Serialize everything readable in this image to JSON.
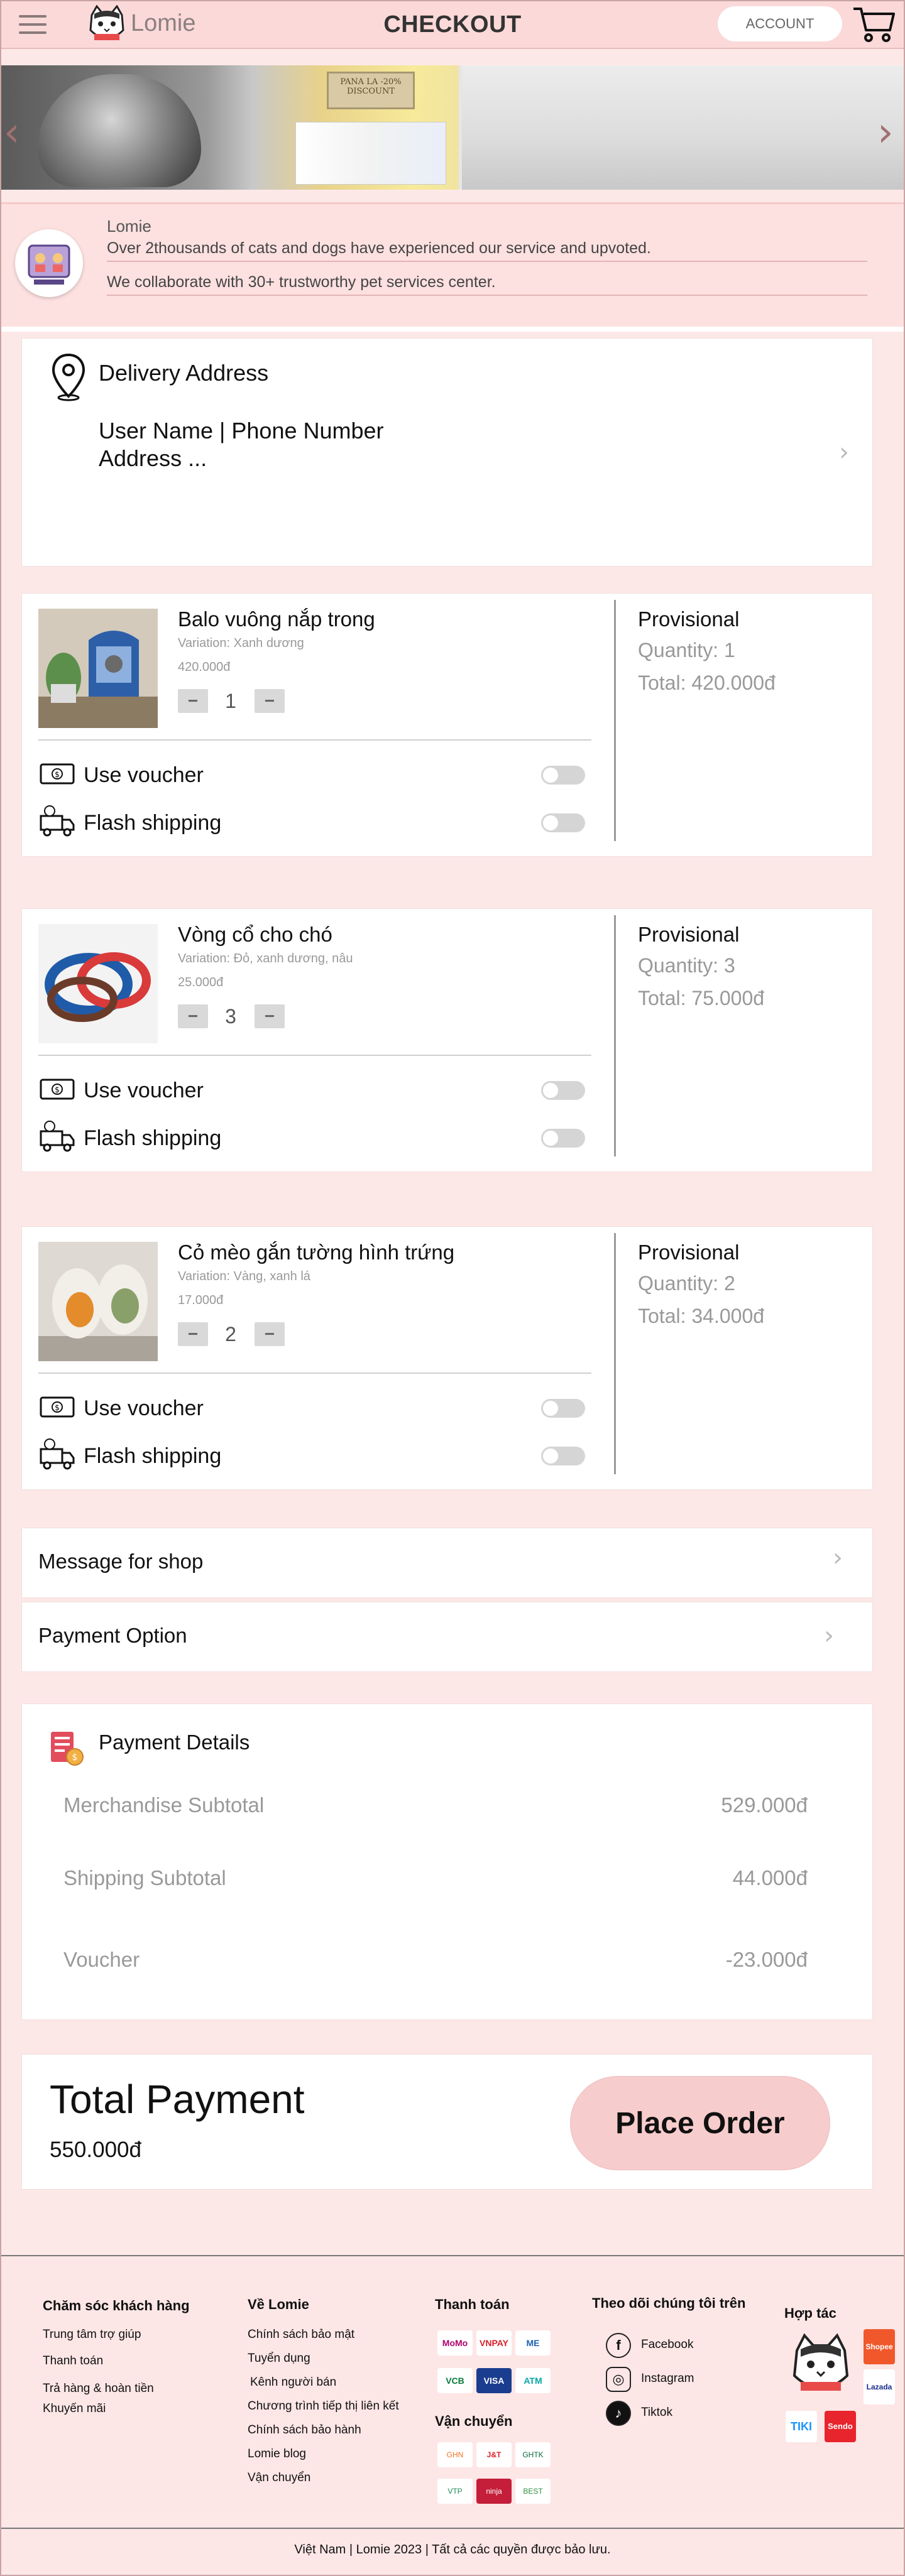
{
  "header": {
    "brand": "Lomie",
    "title": "CHECKOUT",
    "account_label": "ACCOUNT"
  },
  "banner": {
    "sign_text": "PANA LA -20% DISCOUNT"
  },
  "info": {
    "brand": "Lomie",
    "line1": "Over 2thousands of cats and dogs have experienced our service and upvoted.",
    "line2": "We collaborate with 30+ trustworthy pet services center."
  },
  "address": {
    "title": "Delivery Address",
    "user": "User Name | Phone Number",
    "line": "Address ..."
  },
  "items": [
    {
      "name": "Balo vuông nắp trong",
      "variation": "Variation: Xanh dương",
      "price": "420.000đ",
      "qty": "1",
      "use_voucher": "Use voucher",
      "flash": "Flash shipping",
      "prov_title": "Provisional",
      "prov_qty": "Quantity: 1",
      "prov_total": "Total: 420.000đ"
    },
    {
      "name": "Vòng cổ cho chó",
      "variation": "Variation: Đỏ, xanh dương, nâu",
      "price": "25.000đ",
      "qty": "3",
      "use_voucher": "Use voucher",
      "flash": "Flash shipping",
      "prov_title": "Provisional",
      "prov_qty": "Quantity: 3",
      "prov_total": "Total: 75.000đ"
    },
    {
      "name": "Cỏ mèo gắn tường hình trứng",
      "variation": "Variation: Vàng, xanh lá",
      "price": "17.000đ",
      "qty": "2",
      "use_voucher": "Use voucher",
      "flash": "Flash shipping",
      "prov_title": "Provisional",
      "prov_qty": "Quantity: 2",
      "prov_total": "Total: 34.000đ"
    }
  ],
  "rows": {
    "message": "Message for shop",
    "payment_option": "Payment Option"
  },
  "payment_details": {
    "title": "Payment Details",
    "merch_label": "Merchandise Subtotal",
    "merch_val": "529.000đ",
    "ship_label": "Shipping Subtotal",
    "ship_val": "44.000đ",
    "voucher_label": "Voucher",
    "voucher_val": "-23.000đ"
  },
  "total": {
    "label": "Total Payment",
    "value": "550.000đ",
    "place_order": "Place Order"
  },
  "footer": {
    "col1_title": "Chăm sóc khách hàng",
    "col1_links": [
      "Trung tâm trợ giúp",
      "Thanh toán",
      "Trả hàng & hoàn tiền",
      "Khuyến mãi"
    ],
    "col2_title": "Về Lomie",
    "col2_links": [
      "Chính sách bảo mật",
      "Tuyển dụng",
      "Kênh người bán",
      "Chương trình tiếp thị liên kết",
      "Chính sách bảo hành",
      "Lomie blog",
      "Vận chuyển"
    ],
    "col3_title": "Thanh toán",
    "col3b_title": "Vận chuyển",
    "pay_logos": [
      "MoMo",
      "VNPAY",
      "ME",
      "VCB",
      "VISA",
      "ATM"
    ],
    "ship_logos": [
      "GHN",
      "J&T",
      "GHTK",
      "VTP",
      "ninja",
      "BEST"
    ],
    "col4_title": "Theo dõi chúng tôi trên",
    "social": [
      "Facebook",
      "Instagram",
      "Tiktok"
    ],
    "col5_title": "Hợp tác",
    "partners": [
      "Shopee",
      "Lazada",
      "TIKI",
      "Sendo"
    ],
    "copyright": "Việt Nam | Lomie 2023 | Tất cả các quyền được bảo lưu."
  }
}
